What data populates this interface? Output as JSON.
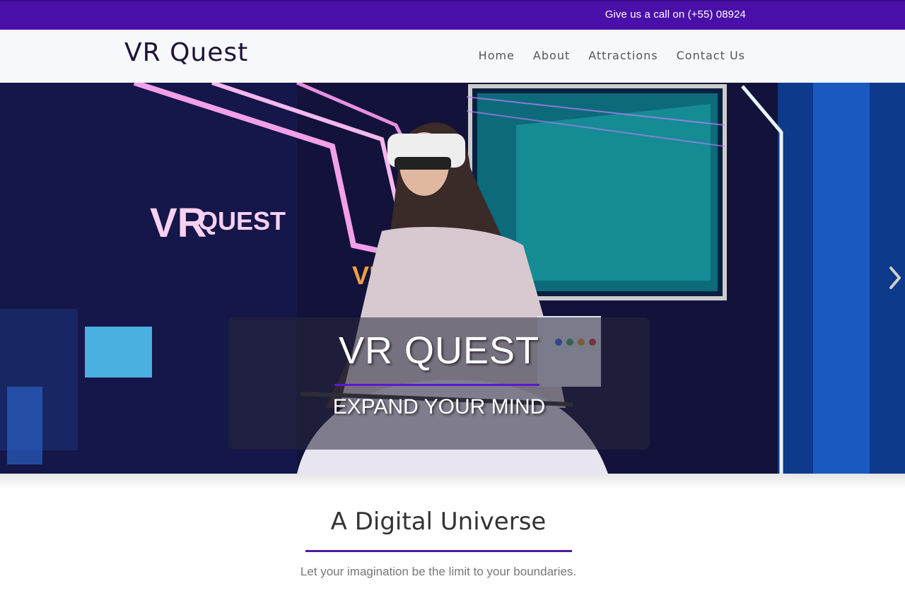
{
  "topbar": {
    "phone_text": "Give us a call on (+55) 08924",
    "background": "#4a0fa8"
  },
  "header": {
    "logo": "VR Quest",
    "nav": [
      {
        "label": "Home"
      },
      {
        "label": "About"
      },
      {
        "label": "Attractions"
      },
      {
        "label": "Contact Us"
      }
    ]
  },
  "hero": {
    "title": "VR QUEST",
    "subtitle": "EXPAND YOUR MIND",
    "sign_text": "VRQUEST",
    "next_icon": "chevron-right-icon",
    "accent": "#5a1ad0"
  },
  "section": {
    "title": "A Digital Universe",
    "text": "Let your imagination be the limit to your boundaries.",
    "accent": "#4a1aa0"
  }
}
